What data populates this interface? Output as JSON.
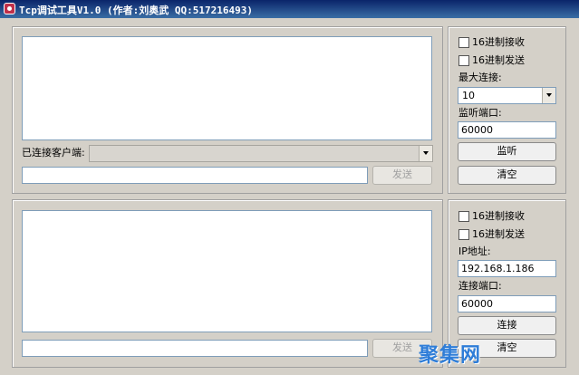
{
  "window": {
    "title": "Tcp调试工具V1.0 (作者:刘奥武 QQ:517216493)"
  },
  "server": {
    "connected_clients_label": "已连接客户端:",
    "send_input_value": "",
    "send_button": "发送",
    "hex_receive_label": "16进制接收",
    "hex_send_label": "16进制发送",
    "max_connections_label": "最大连接:",
    "max_connections_value": "10",
    "listen_port_label": "监听端口:",
    "listen_port_value": "60000",
    "listen_button": "监听",
    "clear_button": "清空"
  },
  "client": {
    "send_input_value": "",
    "send_button": "发送",
    "hex_receive_label": "16进制接收",
    "hex_send_label": "16进制发送",
    "ip_label": "IP地址:",
    "ip_value": "192.168.1.186",
    "port_label": "连接端口:",
    "port_value": "60000",
    "connect_button": "连接",
    "clear_button": "清空"
  },
  "watermark": "聚集网"
}
